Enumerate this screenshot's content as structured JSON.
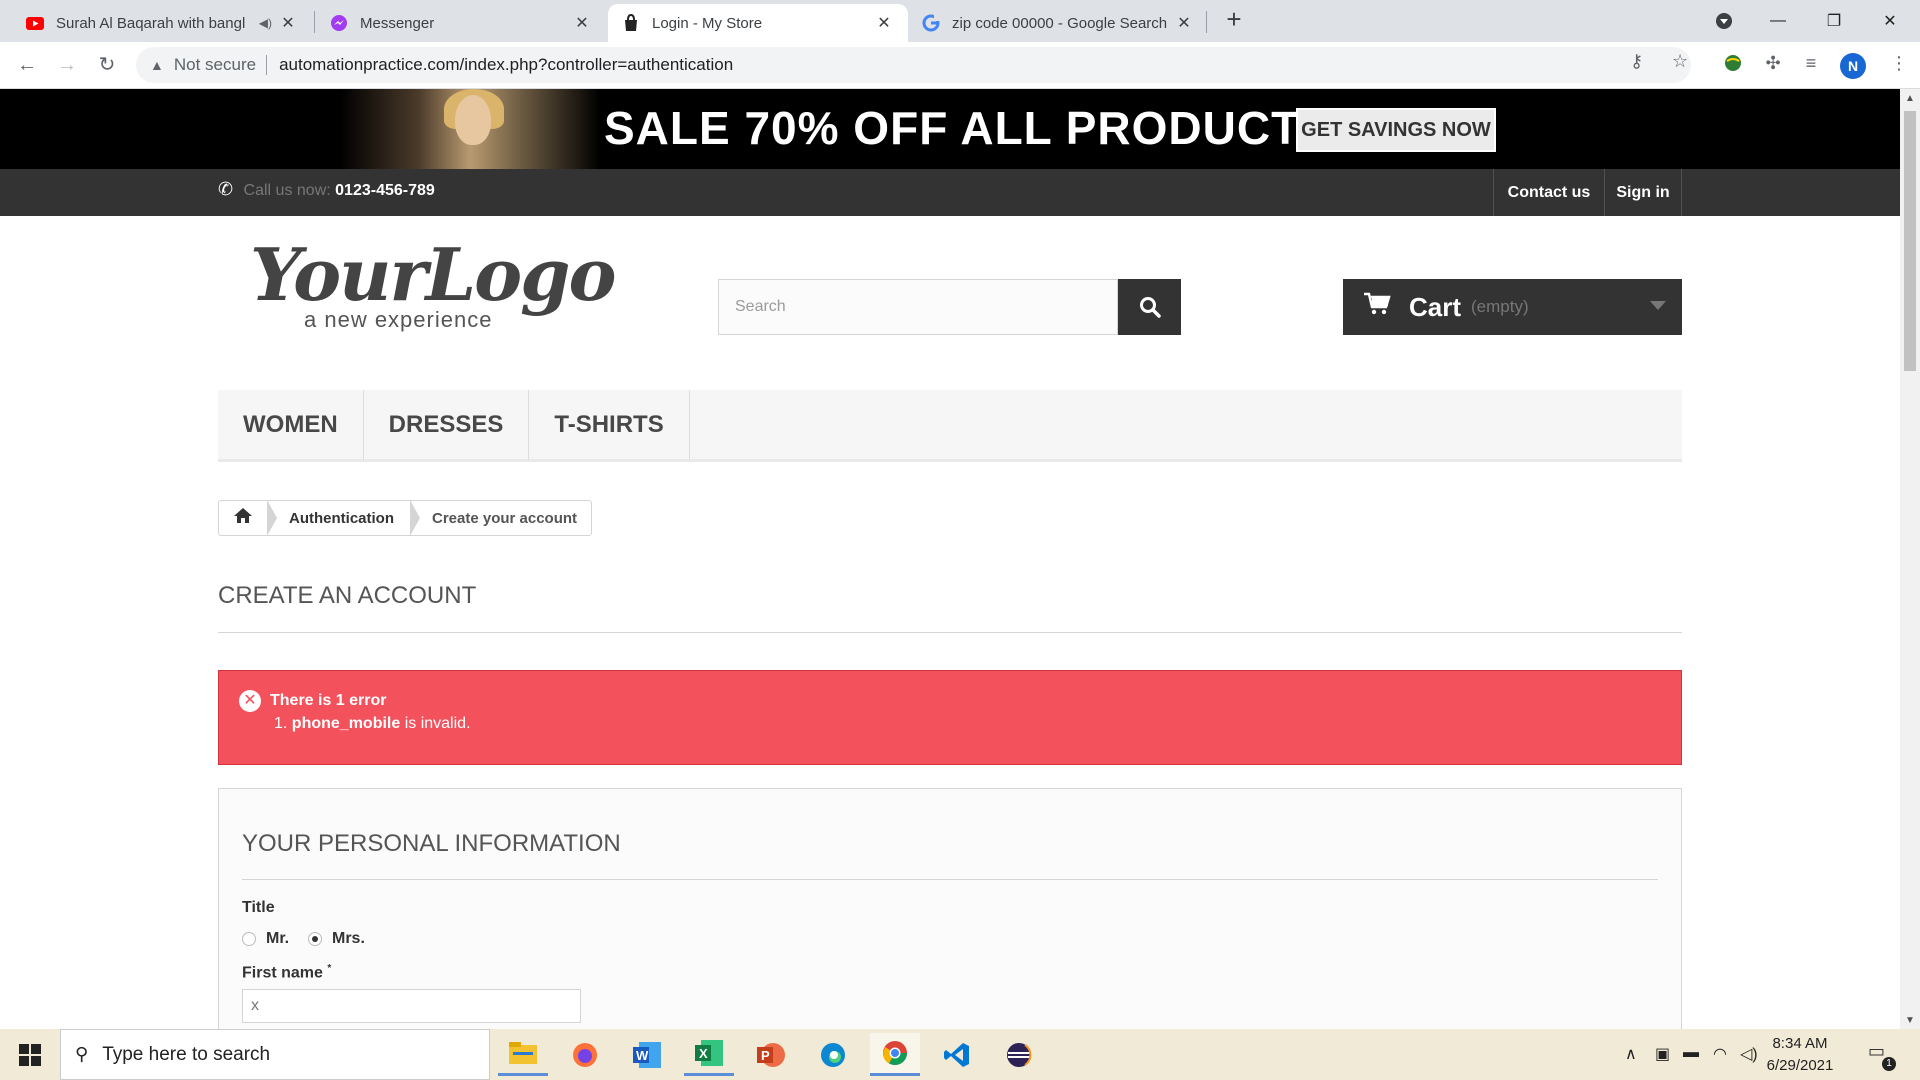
{
  "browser": {
    "tabs": [
      {
        "title": "Surah Al Baqarah with bangl",
        "icon": "youtube-icon"
      },
      {
        "title": "Messenger",
        "icon": "messenger-icon"
      },
      {
        "title": "Login - My Store",
        "icon": "store-icon"
      },
      {
        "title": "zip code 00000 - Google Search",
        "icon": "google-icon"
      }
    ],
    "security_label": "Not secure",
    "url": "automationpractice.com/index.php?controller=authentication",
    "profile_initial": "N"
  },
  "page": {
    "banner": {
      "sale_text": "SALE 70% OFF ALL PRODUCTS",
      "button_label": "GET SAVINGS NOW"
    },
    "header": {
      "call_prefix": "Call us now:",
      "phone": "0123-456-789",
      "contact_label": "Contact us",
      "signin_label": "Sign in"
    },
    "logo": {
      "main": "YourLogo",
      "tagline": "a new experience"
    },
    "search": {
      "placeholder": "Search"
    },
    "cart": {
      "label": "Cart",
      "status": "(empty)"
    },
    "menu": [
      "WOMEN",
      "DRESSES",
      "T-SHIRTS"
    ],
    "breadcrumb": {
      "item1": "Authentication",
      "item2": "Create your account"
    },
    "page_heading": "CREATE AN ACCOUNT",
    "alert": {
      "title": "There is 1 error",
      "item_number": "1.",
      "item_field": "phone_mobile",
      "item_text": "is invalid."
    },
    "form": {
      "section_title": "YOUR PERSONAL INFORMATION",
      "title_label": "Title",
      "title_options": [
        "Mr.",
        "Mrs."
      ],
      "title_selected": "Mrs.",
      "first_name_label": "First name",
      "required_mark": "*",
      "first_name_value": "x"
    }
  },
  "taskbar": {
    "search_placeholder": "Type here to search",
    "time": "8:34 AM",
    "date": "6/29/2021",
    "notification_count": "1"
  },
  "colors": {
    "alert_bg": "#f3515c",
    "dark_bar": "#333333",
    "menu_bg": "#f6f6f6"
  }
}
